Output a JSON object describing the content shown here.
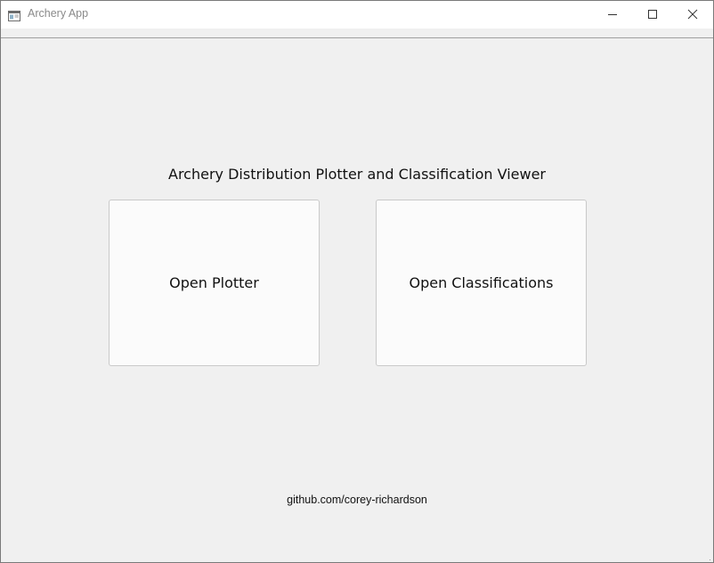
{
  "window": {
    "title": "Archery App",
    "icon": "app-window-icon",
    "controls": [
      "minimize-icon",
      "maximize-icon",
      "close-icon"
    ]
  },
  "main": {
    "heading": "Archery Distribution Plotter and Classification Viewer",
    "buttons": {
      "plotter_label": "Open Plotter",
      "classifications_label": "Open Classifications"
    },
    "footer_link": "github.com/corey-richardson"
  },
  "colors": {
    "background": "#f0f0f0",
    "titlebar": "#ffffff",
    "button_face": "#fbfbfb",
    "button_border": "#c9c9c9",
    "title_text": "#8a8a8a",
    "text": "#111111"
  }
}
